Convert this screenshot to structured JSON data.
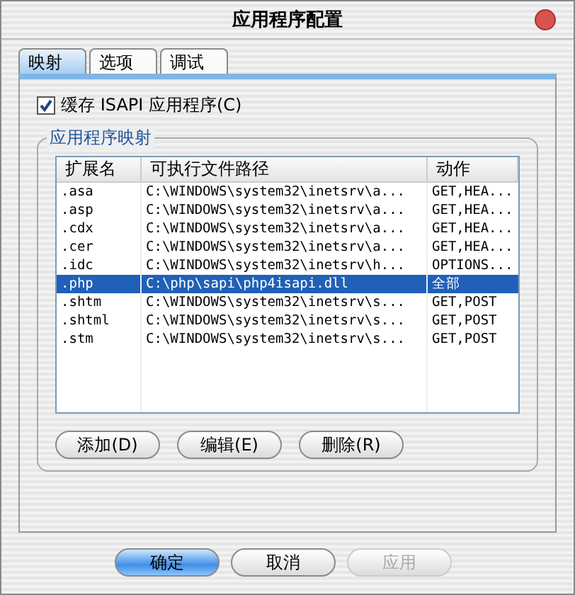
{
  "window": {
    "title": "应用程序配置"
  },
  "tabs": [
    {
      "label": "映射",
      "selected": true
    },
    {
      "label": "选项",
      "selected": false
    },
    {
      "label": "调试",
      "selected": false
    }
  ],
  "cache_checkbox": {
    "label": "缓存 ISAPI 应用程序(C)",
    "checked": true
  },
  "group": {
    "title": "应用程序映射"
  },
  "table": {
    "columns": [
      "扩展名",
      "可执行文件路径",
      "动作"
    ],
    "rows": [
      {
        "cells": [
          ".asa",
          "C:\\WINDOWS\\system32\\inetsrv\\a...",
          "GET,HEA..."
        ],
        "selected": false
      },
      {
        "cells": [
          ".asp",
          "C:\\WINDOWS\\system32\\inetsrv\\a...",
          "GET,HEA..."
        ],
        "selected": false
      },
      {
        "cells": [
          ".cdx",
          "C:\\WINDOWS\\system32\\inetsrv\\a...",
          "GET,HEA..."
        ],
        "selected": false
      },
      {
        "cells": [
          ".cer",
          "C:\\WINDOWS\\system32\\inetsrv\\a...",
          "GET,HEA..."
        ],
        "selected": false
      },
      {
        "cells": [
          ".idc",
          "C:\\WINDOWS\\system32\\inetsrv\\h...",
          "OPTIONS..."
        ],
        "selected": false
      },
      {
        "cells": [
          ".php",
          "C:\\php\\sapi\\php4isapi.dll",
          "全部"
        ],
        "selected": true
      },
      {
        "cells": [
          ".shtm",
          "C:\\WINDOWS\\system32\\inetsrv\\s...",
          "GET,POST"
        ],
        "selected": false
      },
      {
        "cells": [
          ".shtml",
          "C:\\WINDOWS\\system32\\inetsrv\\s...",
          "GET,POST"
        ],
        "selected": false
      },
      {
        "cells": [
          ".stm",
          "C:\\WINDOWS\\system32\\inetsrv\\s...",
          "GET,POST"
        ],
        "selected": false
      }
    ]
  },
  "group_buttons": [
    "添加(D)",
    "编辑(E)",
    "删除(R)"
  ],
  "dialog_buttons": [
    {
      "label": "确定",
      "kind": "default",
      "disabled": false
    },
    {
      "label": "取消",
      "kind": "normal",
      "disabled": false
    },
    {
      "label": "应用",
      "kind": "normal",
      "disabled": true
    }
  ]
}
